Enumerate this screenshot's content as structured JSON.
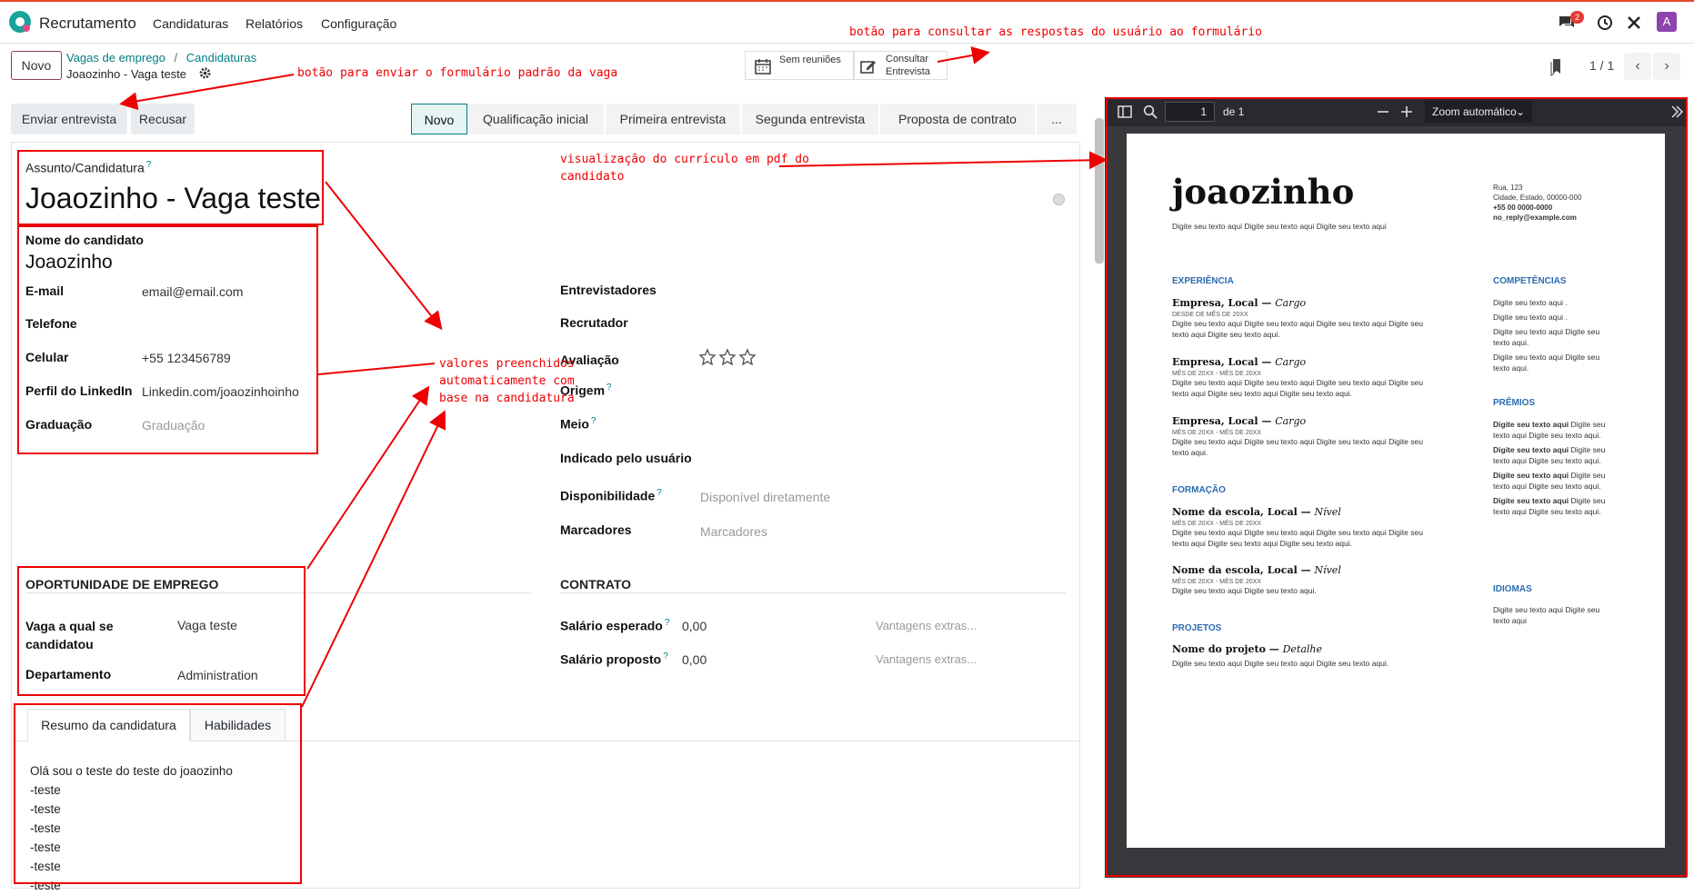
{
  "navbar": {
    "app_name": "Recrutamento",
    "menu": [
      "Candidaturas",
      "Relatórios",
      "Configuração"
    ],
    "chat_badge": "2",
    "avatar": "A"
  },
  "control": {
    "new_button": "Novo",
    "breadcrumb_parent1": "Vagas de emprego",
    "breadcrumb_sep": "/",
    "breadcrumb_parent2": "Candidaturas",
    "record_title": "Joaozinho - Vaga teste",
    "smart_meetings": "Sem reuniões",
    "smart_survey_line1": "Consultar",
    "smart_survey_line2": "Entrevista",
    "pager": "1 / 1"
  },
  "actions": {
    "send_survey": "Enviar entrevista",
    "refuse": "Recusar"
  },
  "stages": [
    "Novo",
    "Qualificação inicial",
    "Primeira entrevista",
    "Segunda entrevista",
    "Proposta de contrato",
    "..."
  ],
  "form": {
    "subject_label": "Assunto/Candidatura",
    "subject_value": "Joaozinho - Vaga teste",
    "candidate_label": "Nome do candidato",
    "candidate_value": "Joaozinho",
    "email_label": "E-mail",
    "email_value": "email@email.com",
    "phone_label": "Telefone",
    "phone_value": "",
    "mobile_label": "Celular",
    "mobile_value": "+55 123456789",
    "linkedin_label": "Perfil do LinkedIn",
    "linkedin_value": "Linkedin.com/joaozinhoinho",
    "degree_label": "Graduação",
    "degree_placeholder": "Graduação",
    "interviewers_label": "Entrevistadores",
    "recruiter_label": "Recrutador",
    "rating_label": "Avaliação",
    "origin_label": "Origem",
    "medium_label": "Meio",
    "referred_label": "Indicado pelo usuário",
    "availability_label": "Disponibilidade",
    "availability_placeholder": "Disponível diretamente",
    "tags_label": "Marcadores",
    "tags_placeholder": "Marcadores",
    "job_section": "OPORTUNIDADE DE EMPREGO",
    "job_label": "Vaga a qual se candidatou",
    "job_value": "Vaga teste",
    "department_label": "Departamento",
    "department_value": "Administration",
    "contract_section": "CONTRATO",
    "expected_salary_label": "Salário esperado",
    "expected_salary_value": "0,00",
    "expected_extra_placeholder": "Vantagens extras...",
    "proposed_salary_label": "Salário proposto",
    "proposed_salary_value": "0,00",
    "proposed_extra_placeholder": "Vantagens extras...",
    "tabs": [
      "Resumo da candidatura",
      "Habilidades"
    ],
    "summary_lines": [
      "Olá sou o teste do teste do joaozinho",
      "-teste",
      "-teste",
      "-teste",
      "-teste",
      "-teste",
      "-teste"
    ]
  },
  "annotations": {
    "survey": "botão para consultar as respostas do usuário ao formulário",
    "send": "botão para enviar o formulário padrão da vaga",
    "pdf": [
      "visualização do currículo em pdf do",
      "candidato"
    ],
    "filled": [
      "valores preenchidos",
      "automaticamente com",
      "base na candidatura"
    ]
  },
  "pdf_viewer": {
    "page_input": "1",
    "page_of": "de 1",
    "zoom": "Zoom automático"
  },
  "resume": {
    "name": "joaozinho",
    "tagline": "Digite seu texto aqui Digite seu texto aqui Digite seu texto aqui",
    "address": "Rua, 123",
    "city": "Cidade, Estado, 00000-000",
    "phone": "+55 00 0000-0000",
    "email": "no_reply@example.com",
    "exp_title": "EXPERIÊNCIA",
    "jobs": [
      {
        "head": "Empresa, Local",
        "role": "Cargo",
        "date": "DESDE DE MÊS DE 20XX",
        "text": "Digite seu texto aqui Digite seu texto aqui Digite seu texto aqui Digite seu texto aqui Digite seu texto aqui."
      },
      {
        "head": "Empresa, Local",
        "role": "Cargo",
        "date": "MÊS DE 20XX - MÊS DE 20XX",
        "text": "Digite seu texto aqui Digite seu texto aqui Digite seu texto aqui Digite seu texto aqui Digite seu texto aqui Digite seu texto aqui."
      },
      {
        "head": "Empresa, Local",
        "role": "Cargo",
        "date": "MÊS DE 20XX - MÊS DE 20XX",
        "text": "Digite seu texto aqui Digite seu texto aqui Digite seu texto aqui Digite seu texto aqui."
      }
    ],
    "edu_title": "FORMAÇÃO",
    "schools": [
      {
        "head": "Nome da escola, Local",
        "level": "Nível",
        "date": "MÊS DE 20XX - MÊS DE 20XX",
        "text": "Digite seu texto aqui Digite seu texto aqui Digite seu texto aqui Digite seu texto aqui Digite seu texto aqui Digite seu texto aqui."
      },
      {
        "head": "Nome da escola, Local",
        "level": "Nível",
        "date": "MÊS DE 20XX - MÊS DE 20XX",
        "text": "Digite seu texto aqui Digite seu texto aqui."
      }
    ],
    "proj_title": "PROJETOS",
    "project_head": "Nome do projeto",
    "project_detail": "Detalhe",
    "project_text": "Digite seu texto aqui Digite seu texto aqui Digite seu texto aqui.",
    "skills_title": "COMPETÊNCIAS",
    "skills": [
      "Digite seu texto aqui .",
      "Digite seu texto aqui .",
      "Digite seu texto aqui Digite seu texto aqui.",
      "Digite seu texto aqui Digite seu texto aqui."
    ],
    "awards_title": "PRÊMIOS",
    "award_bold": "Digite seu texto aqui",
    "award_text": "Digite seu texto aqui Digite seu texto aqui.",
    "lang_title": "IDIOMAS",
    "lang_text": "Digite seu texto aqui Digite seu texto aqui"
  }
}
